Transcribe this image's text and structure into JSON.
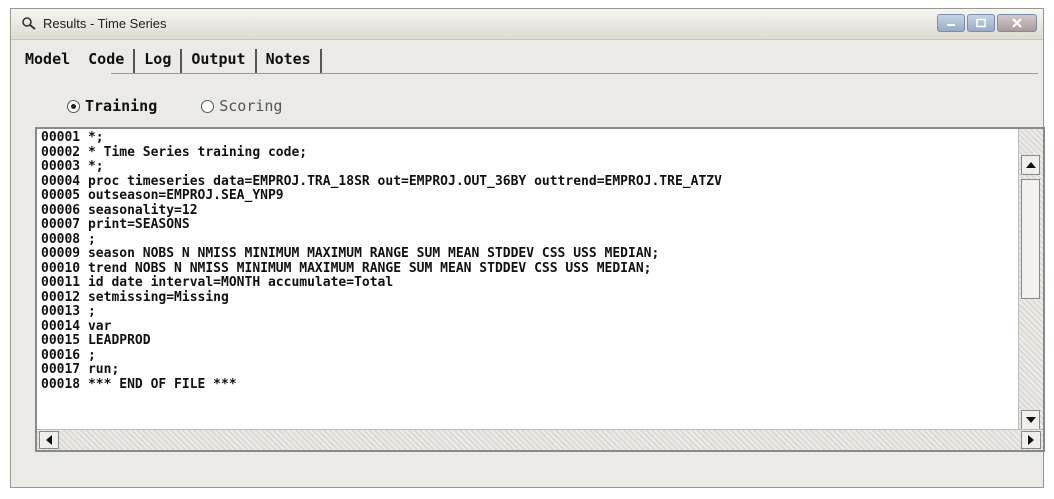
{
  "window": {
    "title": "Results - Time Series"
  },
  "tabs": [
    {
      "label": "Model"
    },
    {
      "label": "Code"
    },
    {
      "label": "Log"
    },
    {
      "label": "Output"
    },
    {
      "label": "Notes"
    }
  ],
  "active_tab": "Code",
  "radios": {
    "training": {
      "label": "Training",
      "selected": true
    },
    "scoring": {
      "label": "Scoring",
      "selected": false
    }
  },
  "code_lines": [
    "00001 *;",
    "00002 * Time Series training code;",
    "00003 *;",
    "00004 proc timeseries data=EMPROJ.TRA_18SR out=EMPROJ.OUT_36BY outtrend=EMPROJ.TRE_ATZV",
    "00005 outseason=EMPROJ.SEA_YNP9",
    "00006 seasonality=12",
    "00007 print=SEASONS",
    "00008 ;",
    "00009 season NOBS N NMISS MINIMUM MAXIMUM RANGE SUM MEAN STDDEV CSS USS MEDIAN;",
    "00010 trend NOBS N NMISS MINIMUM MAXIMUM RANGE SUM MEAN STDDEV CSS USS MEDIAN;",
    "00011 id date interval=MONTH accumulate=Total",
    "00012 setmissing=Missing",
    "00013 ;",
    "00014 var",
    "00015 LEADPROD",
    "00016 ;",
    "00017 run;",
    "00018 *** END OF FILE ***"
  ],
  "icons": {
    "title": "results-icon",
    "minimize": "minimize-icon",
    "maximize": "maximize-icon",
    "close": "close-icon"
  }
}
